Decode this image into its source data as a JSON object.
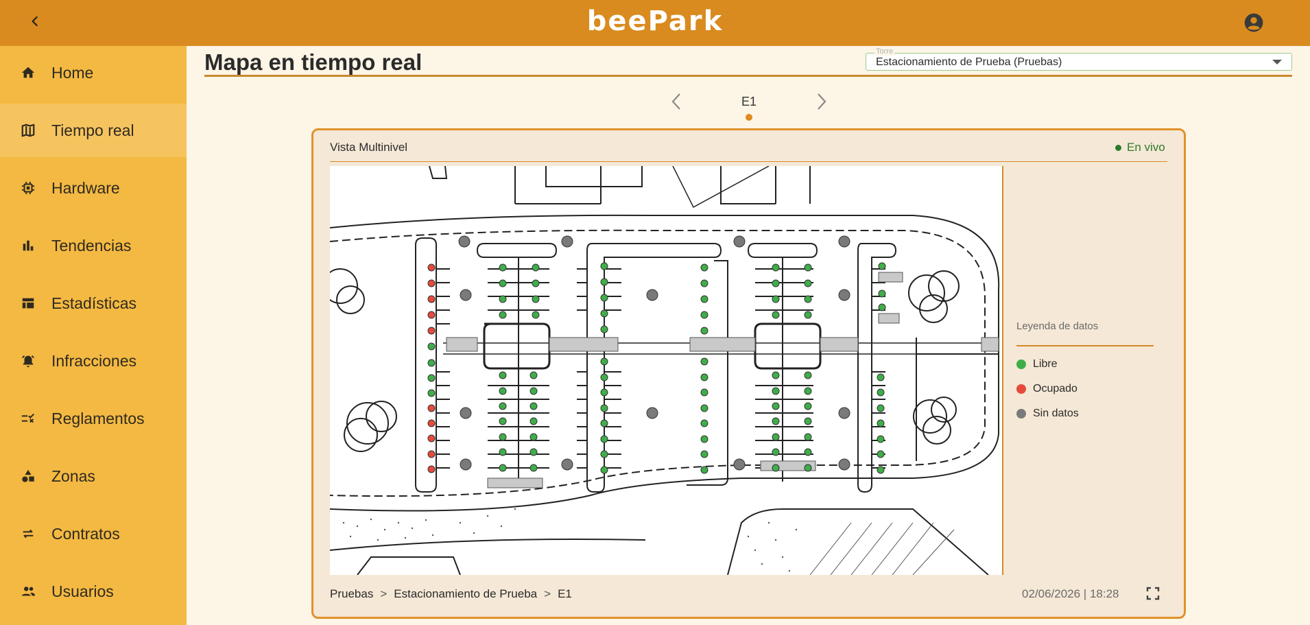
{
  "app": {
    "brand": "beePark"
  },
  "sidebar": {
    "items": [
      {
        "label": "Home",
        "icon": "home-icon"
      },
      {
        "label": "Tiempo real",
        "icon": "map-icon"
      },
      {
        "label": "Hardware",
        "icon": "chip-icon"
      },
      {
        "label": "Tendencias",
        "icon": "bar-chart-icon"
      },
      {
        "label": "Estadísticas",
        "icon": "table-icon"
      },
      {
        "label": "Infracciones",
        "icon": "alarm-icon"
      },
      {
        "label": "Reglamentos",
        "icon": "rule-icon"
      },
      {
        "label": "Zonas",
        "icon": "shapes-icon"
      },
      {
        "label": "Contratos",
        "icon": "swap-icon"
      },
      {
        "label": "Usuarios",
        "icon": "group-icon"
      }
    ],
    "active_index": 1
  },
  "main": {
    "title": "Mapa en tiempo real",
    "tower_select": {
      "label": "Torre",
      "value": "Estacionamiento de Prueba (Pruebas)"
    },
    "level": {
      "current": "E1"
    }
  },
  "card": {
    "title": "Vista Multinivel",
    "status": "En vivo",
    "legend": {
      "title": "Leyenda de datos",
      "items": [
        {
          "label": "Libre",
          "color": "#3fae49"
        },
        {
          "label": "Ocupado",
          "color": "#e64a3b"
        },
        {
          "label": "Sin datos",
          "color": "#7a7a7a"
        }
      ]
    },
    "breadcrumb": [
      "Pruebas",
      "Estacionamiento de Prueba",
      "E1"
    ],
    "breadcrumb_sep": ">",
    "timestamp": "02/06/2026 | 18:28"
  },
  "colors": {
    "topbar": "#d98b1f",
    "sidebar": "#f4b942",
    "accent": "#e0922a",
    "free": "#3fae49",
    "occupied": "#e64a3b",
    "nodata": "#7a7a7a"
  }
}
